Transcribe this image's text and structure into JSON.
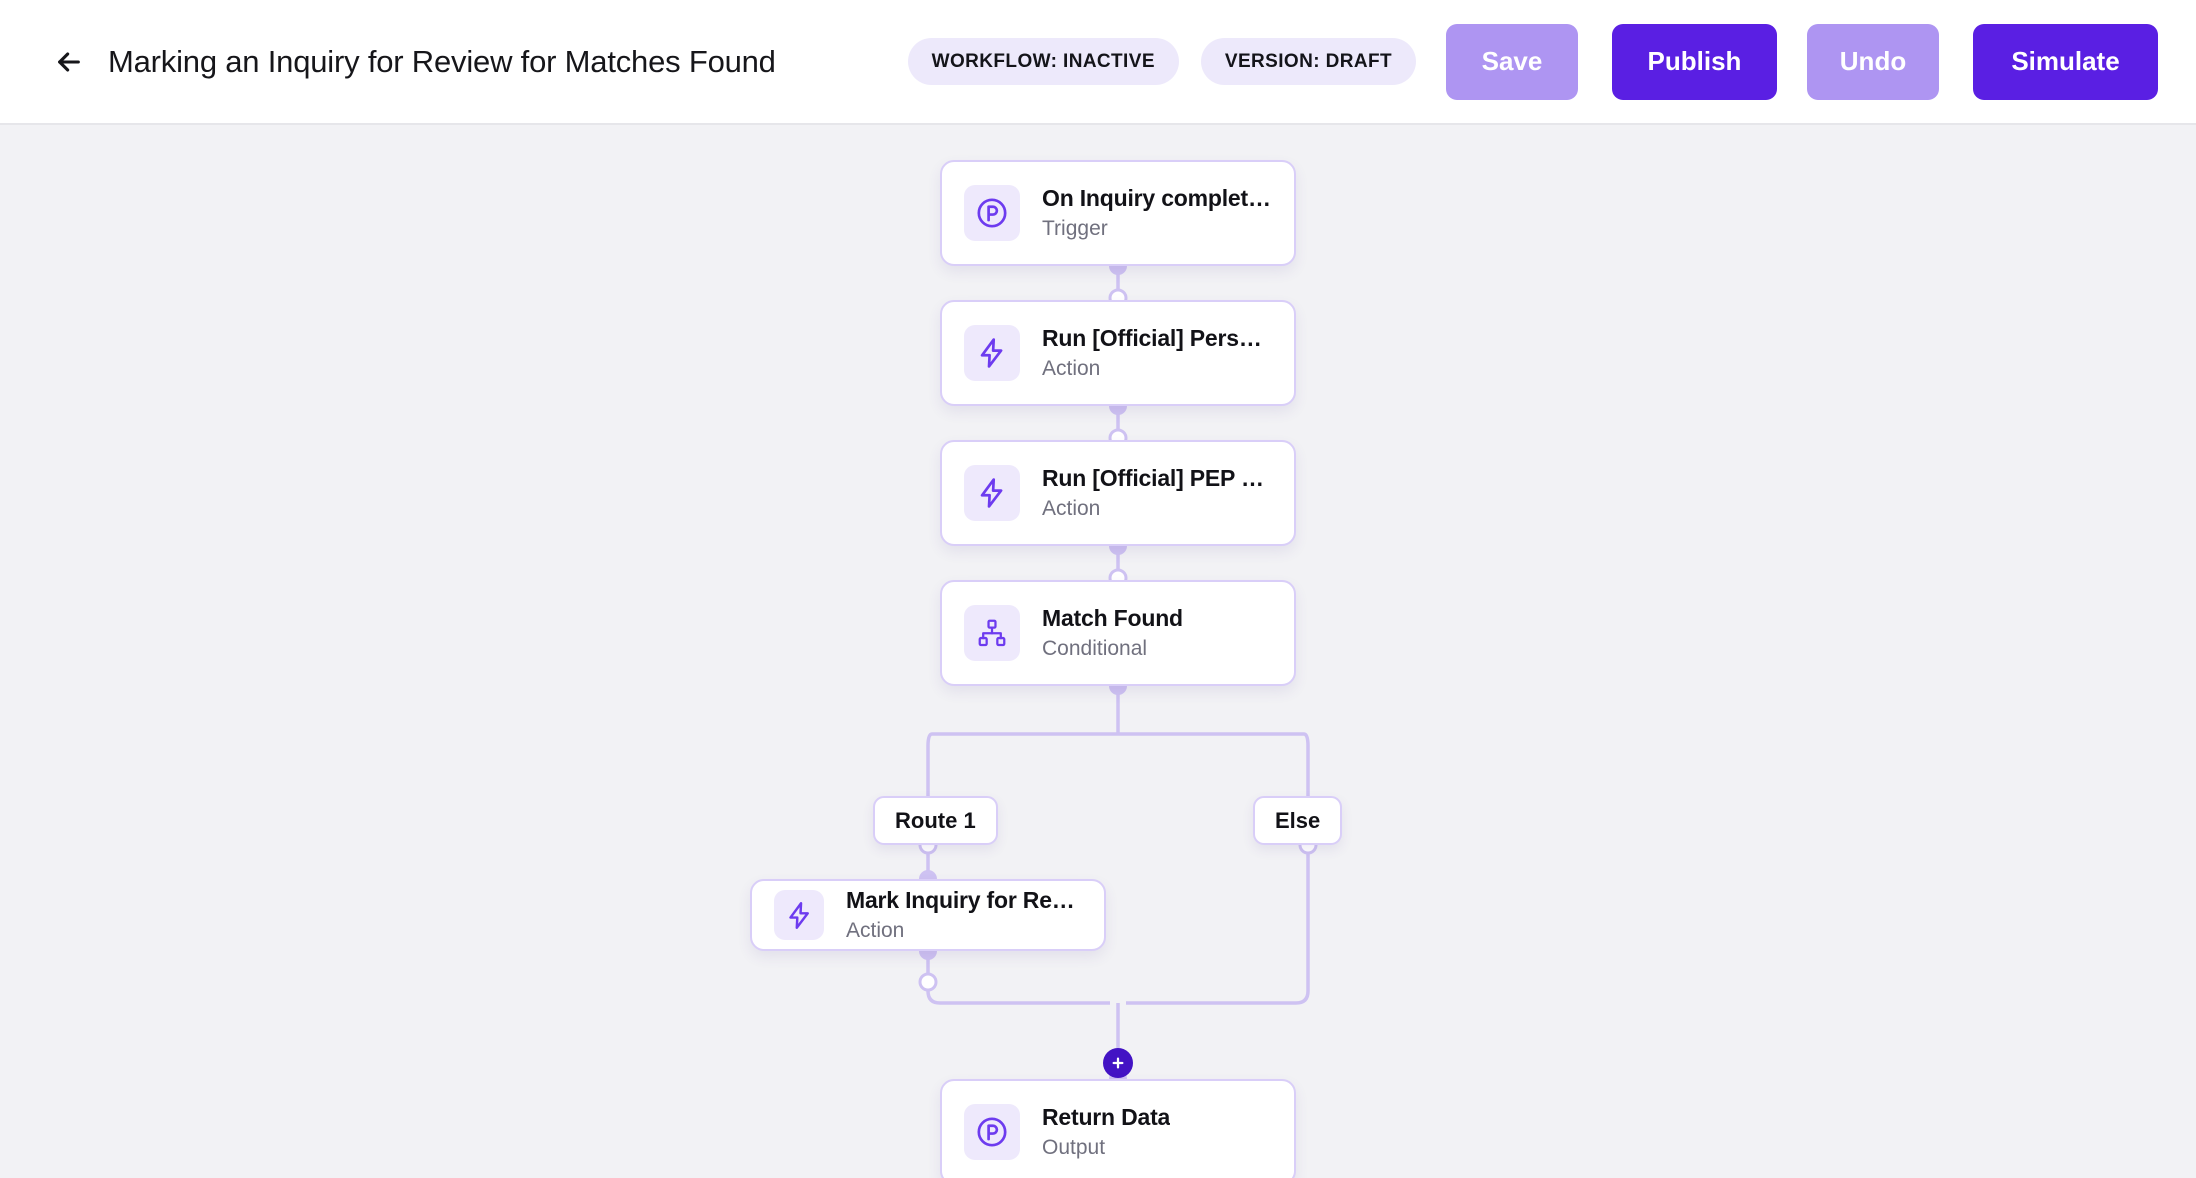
{
  "header": {
    "back_icon": "arrow-left-icon",
    "title": "Marking an Inquiry for Review for Matches Found",
    "badges": [
      {
        "label": "WORKFLOW: INACTIVE"
      },
      {
        "label": "VERSION: DRAFT"
      }
    ],
    "buttons": [
      {
        "name": "save",
        "label": "Save",
        "style": "muted"
      },
      {
        "name": "publish",
        "label": "Publish",
        "style": "primary"
      },
      {
        "name": "undo",
        "label": "Undo",
        "style": "muted"
      },
      {
        "name": "simulate",
        "label": "Simulate",
        "style": "primary"
      }
    ]
  },
  "colors": {
    "canvas_bg": "#F2F2F5",
    "header_bg": "#FFFFFF",
    "accent_primary": "#5A1FE3",
    "accent_muted": "#AE95F2",
    "badge_bg": "#EDE9FB",
    "node_border": "#D9CEF8",
    "edge": "#CEC2F2",
    "node_icon_bg": "#EEE9FC",
    "icon_purple": "#6D3BEF",
    "add_button": "#4313C4"
  },
  "workflow": {
    "nodes": [
      {
        "id": "trigger",
        "title": "On Inquiry completed",
        "subtitle": "Trigger",
        "icon": "persona-p-circle-icon"
      },
      {
        "id": "action1",
        "title": "Run [Official] Person Wat…",
        "subtitle": "Action",
        "icon": "lightning-bolt-icon"
      },
      {
        "id": "action2",
        "title": "Run [Official] PEP Report…",
        "subtitle": "Action",
        "icon": "lightning-bolt-icon"
      },
      {
        "id": "condition",
        "title": "Match Found",
        "subtitle": "Conditional",
        "icon": "sitemap-icon"
      },
      {
        "id": "action3",
        "title": "Mark Inquiry for Review",
        "subtitle": "Action",
        "icon": "lightning-bolt-icon"
      },
      {
        "id": "output",
        "title": "Return Data",
        "subtitle": "Output",
        "icon": "persona-p-circle-icon"
      }
    ],
    "branches": [
      {
        "id": "route1",
        "label": "Route 1"
      },
      {
        "id": "else",
        "label": "Else"
      }
    ],
    "add_button_icon": "plus-icon"
  }
}
